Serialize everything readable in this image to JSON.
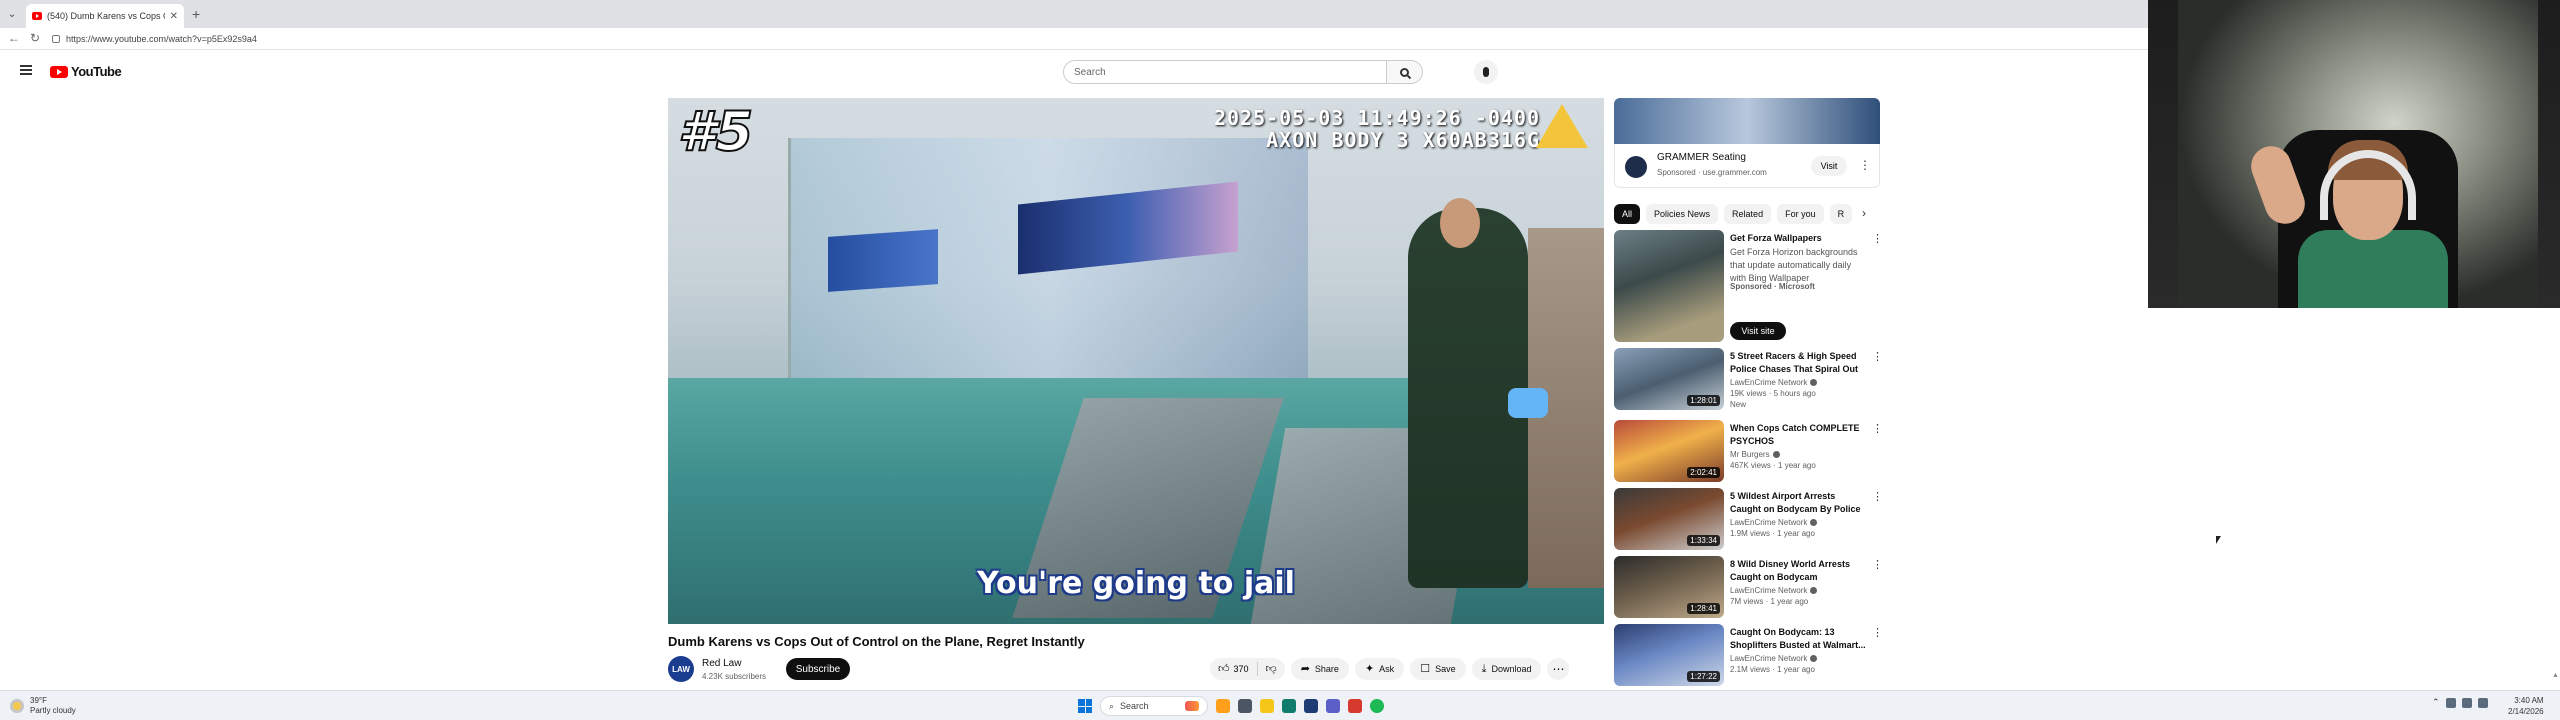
{
  "browser": {
    "tab_title": "(540) Dumb Karens vs Cops O",
    "url": "https://www.youtube.com/watch?v=p5Ex92s9a4"
  },
  "header": {
    "logo_text": "YouTube",
    "search_placeholder": "Search"
  },
  "player": {
    "episode_number": "#5",
    "bodycam_timestamp": "2025-05-03 11:49:26 -0400",
    "bodycam_device": "AXON BODY 3 X60AB316G",
    "caption": "You're going to jail"
  },
  "video": {
    "title": "Dumb Karens vs Cops Out of Control on the Plane, Regret Instantly",
    "channel_avatar_text": "LAW",
    "channel_name": "Red Law",
    "subscribers": "4.23K subscribers",
    "subscribe_label": "Subscribe",
    "like_count": "370",
    "share_label": "Share",
    "ask_label": "Ask",
    "save_label": "Save",
    "download_label": "Download"
  },
  "sidebar": {
    "ad": {
      "title": "GRAMMER Seating",
      "meta": "Sponsored · use.grammer.com",
      "visit_label": "Visit"
    },
    "chips": [
      "All",
      "Policies News",
      "Related",
      "For you",
      "R"
    ],
    "recommendations": [
      {
        "title": "Get Forza Wallpapers",
        "description": "Get Forza Horizon backgrounds that update automatically daily with Bing Wallpaper",
        "sponsor": "Sponsored · Microsoft",
        "action_label": "Visit site"
      },
      {
        "title": "5 Street Racers & High Speed Police Chases That Spiral Out ...",
        "channel": "LawEnCrime Network",
        "meta": "19K views · 5 hours ago",
        "badge": "New",
        "duration": "1:28:01"
      },
      {
        "title": "When Cops Catch COMPLETE PSYCHOS",
        "channel": "Mr Burgers",
        "meta": "467K views · 1 year ago",
        "duration": "2:02:41"
      },
      {
        "title": "5 Wildest Airport Arrests Caught on Bodycam By Police",
        "channel": "LawEnCrime Network",
        "meta": "1.9M views · 1 year ago",
        "duration": "1:33:34"
      },
      {
        "title": "8 Wild Disney World Arrests Caught on Bodycam",
        "channel": "LawEnCrime Network",
        "meta": "7M views · 1 year ago",
        "duration": "1:28:41"
      },
      {
        "title": "Caught On Bodycam: 13 Shoplifters Busted at Walmart...",
        "channel": "LawEnCrime Network",
        "meta": "2.1M views · 1 year ago",
        "duration": "1:27:22"
      }
    ]
  },
  "taskbar": {
    "weather_temp": "39°F",
    "weather_desc": "Partly cloudy",
    "search_label": "Search",
    "time": "3:40 AM",
    "date": "2/14/2026"
  },
  "colors": {
    "youtube_red": "#ff0000",
    "subscribe_black": "#0f0f0f",
    "caption_outline": "#1e3b8a",
    "axon_yellow": "#f3c53b"
  }
}
